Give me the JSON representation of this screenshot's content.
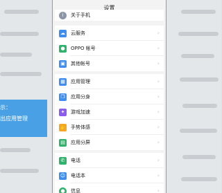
{
  "background": {
    "tip_lines": [
      "示：",
      "出应用管理"
    ]
  },
  "screen": {
    "title": "设置",
    "groups": [
      {
        "items": [
          {
            "label": "关于手机",
            "icon": "info-icon",
            "color": "#8a96a8"
          }
        ]
      },
      {
        "items": [
          {
            "label": "云服务",
            "icon": "cloud-icon",
            "color": "#3d8ef0"
          },
          {
            "label": "OPPO 帐号",
            "icon": "account-icon",
            "color": "#2fb36c"
          },
          {
            "label": "其他帐号",
            "icon": "accounts-icon",
            "color": "#3d8ef0"
          }
        ]
      },
      {
        "items": [
          {
            "label": "应用管理",
            "icon": "apps-icon",
            "color": "#3d8ef0"
          },
          {
            "label": "应用分身",
            "icon": "clone-icon",
            "color": "#3d8ef0"
          },
          {
            "label": "游戏加速",
            "icon": "game-icon",
            "color": "#8c5cf0"
          },
          {
            "label": "手势体感",
            "icon": "gesture-icon",
            "color": "#f5a623"
          },
          {
            "label": "应用分屏",
            "icon": "split-screen-icon",
            "color": "#2fb36c"
          }
        ]
      },
      {
        "items": [
          {
            "label": "电话",
            "icon": "phone-icon",
            "color": "#2fb36c"
          },
          {
            "label": "电话本",
            "icon": "contacts-icon",
            "color": "#3d8ef0"
          },
          {
            "label": "信息",
            "icon": "message-icon",
            "color": "#2fb36c"
          }
        ]
      }
    ]
  }
}
